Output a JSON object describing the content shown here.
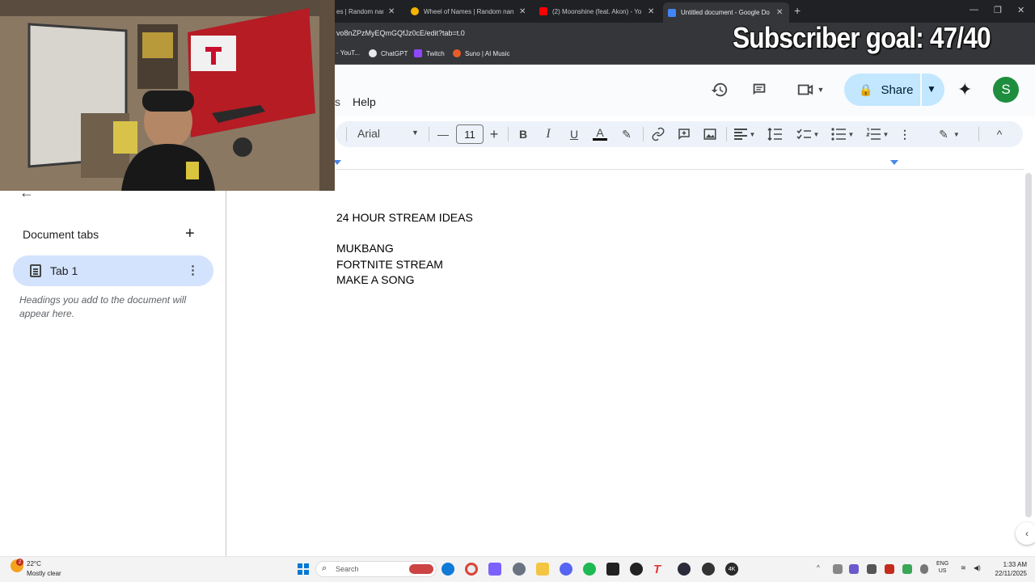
{
  "browser": {
    "tabs": [
      {
        "label": "es | Random nam",
        "color": "#c7c9cc"
      },
      {
        "label": "Wheel of Names | Random nan",
        "color": "#f4b400"
      },
      {
        "label": "(2) Moonshine (feat. Akon) - Yo",
        "color": "#ff0000"
      },
      {
        "label": "Untitled document - Google Do",
        "color": "#4285f4"
      }
    ],
    "url": "vo8nZPzMyEQmGQfJz0cE/edit?tab=t.0",
    "bookmarks": [
      {
        "label": "- YouT...",
        "color": "#ff0000"
      },
      {
        "label": "ChatGPT",
        "color": "#e8eaed"
      },
      {
        "label": "Twitch",
        "color": "#9146ff"
      },
      {
        "label": "Suno | AI Music",
        "color": "#e85d27"
      }
    ]
  },
  "overlay": {
    "subscriber_goal": "Subscriber goal: 47/40"
  },
  "docs": {
    "menu_partial": "s",
    "menu_help": "Help",
    "share_label": "Share",
    "avatar_letter": "S",
    "toolbar": {
      "font": "Arial",
      "font_size": "11"
    },
    "sidebar": {
      "title": "Document tabs",
      "tab_label": "Tab 1",
      "hint": "Headings you add to the document will appear here."
    },
    "content": [
      "24 HOUR STREAM IDEAS",
      "",
      "MUKBANG",
      "FORTNITE STREAM",
      "MAKE A SONG"
    ]
  },
  "taskbar": {
    "weather_temp": "22°C",
    "weather_cond": "Mostly clear",
    "weather_badge": "2",
    "search_placeholder": "Search",
    "lang": "ENG",
    "region": "US",
    "time": "1:33 AM",
    "date": "22/11/2025"
  }
}
